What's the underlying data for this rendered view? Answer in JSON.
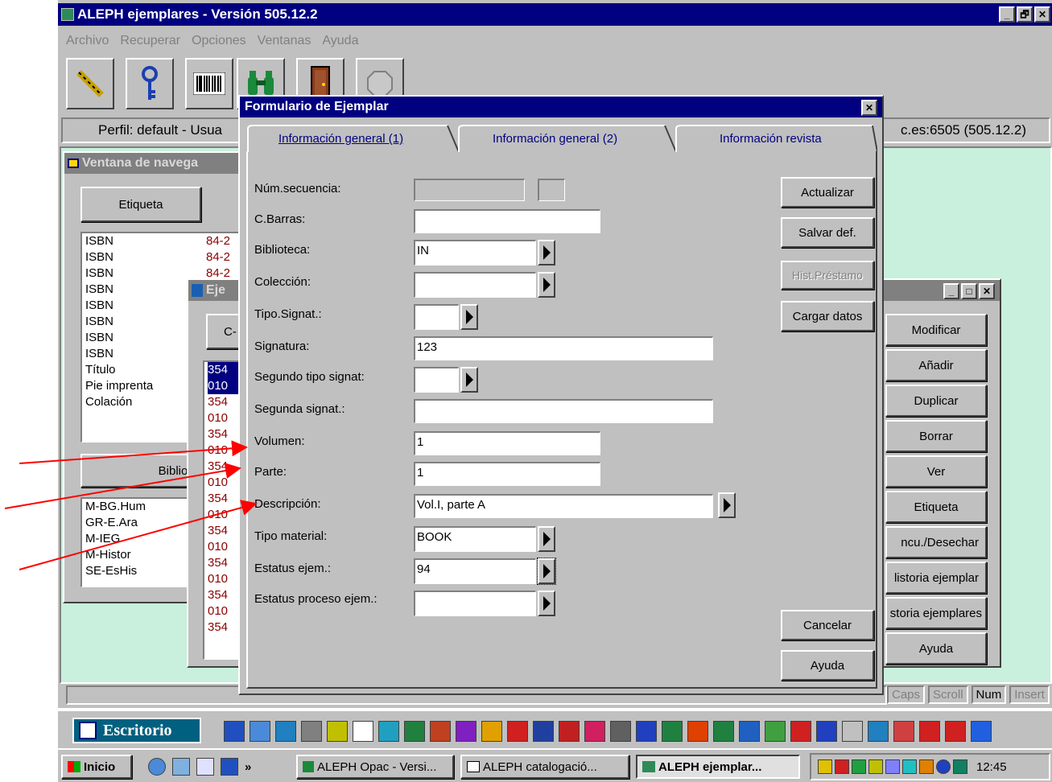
{
  "app": {
    "title": "ALEPH ejemplares - Versión 505.12.2",
    "window_buttons": [
      "_",
      "🗗",
      "✕"
    ],
    "menu": [
      "Archivo",
      "Recuperar",
      "Opciones",
      "Ventanas",
      "Ayuda"
    ],
    "toolbar_icons": [
      "connect-icon",
      "key-icon",
      "barcode-icon",
      "binoculars-icon",
      "door-icon",
      "blank-icon"
    ],
    "profile_left": "Perfil: default - Usua",
    "profile_right": "c.es:6505 (505.12.2)"
  },
  "nav_window": {
    "title": "Ventana de navega",
    "tab": "Etiqueta",
    "rows": [
      {
        "label": "ISBN",
        "value": "84-2"
      },
      {
        "label": "ISBN",
        "value": "84-2"
      },
      {
        "label": "ISBN",
        "value": "84-2"
      },
      {
        "label": "ISBN",
        "value": ""
      },
      {
        "label": "ISBN",
        "value": ""
      },
      {
        "label": "ISBN",
        "value": ""
      },
      {
        "label": "ISBN",
        "value": ""
      },
      {
        "label": "ISBN",
        "value": ""
      },
      {
        "label": "Título",
        "value": ""
      },
      {
        "label": "Pie imprenta",
        "value": ""
      },
      {
        "label": "Colación",
        "value": ""
      }
    ],
    "bibliotec_button": "Bibliotec",
    "libraries": [
      "M-BG.Hum",
      "GR-E.Ara",
      "M-IEG",
      "M-Histor",
      "SE-EsHis"
    ]
  },
  "ej_window": {
    "title": "Eje",
    "tab": "C-",
    "codes": [
      "354",
      "010",
      "354",
      "010",
      "354",
      "010",
      "354",
      "010",
      "354",
      "010",
      "354",
      "010",
      "354",
      "010",
      "354",
      "010",
      "354"
    ]
  },
  "right_panel": {
    "buttons": [
      "Modificar",
      "Añadir",
      "Duplicar",
      "Borrar",
      "Ver",
      "Etiqueta",
      "ncu./Desechar",
      "listoria ejemplar",
      "storia ejemplares",
      "Ayuda"
    ]
  },
  "status_bar": {
    "indicators": [
      "Caps",
      "Scroll",
      "Num",
      "Insert"
    ]
  },
  "dialog": {
    "title": "Formulario de Ejemplar",
    "close": "✕",
    "tabs": [
      "Información general (1)",
      "Información general (2)",
      "Información revista"
    ],
    "fields": [
      {
        "label": "Núm.secuencia:",
        "value": ""
      },
      {
        "label": "C.Barras:",
        "value": ""
      },
      {
        "label": "Biblioteca:",
        "value": "IN"
      },
      {
        "label": "Colección:",
        "value": ""
      },
      {
        "label": "Tipo.Signat.:",
        "value": ""
      },
      {
        "label": "Signatura:",
        "value": "123"
      },
      {
        "label": "Segundo tipo signat:",
        "value": ""
      },
      {
        "label": "Segunda signat.:",
        "value": ""
      },
      {
        "label": "Volumen:",
        "value": "1"
      },
      {
        "label": "Parte:",
        "value": "1"
      },
      {
        "label": "Descripción:",
        "value": "Vol.I, parte A"
      },
      {
        "label": "Tipo material:",
        "value": "BOOK"
      },
      {
        "label": "Estatus ejem.:",
        "value": "94"
      },
      {
        "label": "Estatus proceso ejem.:",
        "value": ""
      }
    ],
    "buttons": {
      "actualizar": "Actualizar",
      "salvar": "Salvar def.",
      "hist": "Hist.Préstamo",
      "cargar": "Cargar datos",
      "cancelar": "Cancelar",
      "ayuda": "Ayuda"
    }
  },
  "taskbar_top": {
    "label": "Escritorio"
  },
  "taskbar": {
    "start": "Inicio",
    "tasks": [
      "ALEPH Opac - Versi...",
      "ALEPH catalogació...",
      "ALEPH ejemplar..."
    ],
    "clock": "12:45"
  },
  "colors": {
    "title_active": "#000080",
    "workspace": "#c8f0dc",
    "gray": "#c0c0c0",
    "annotation": "#ff0000",
    "selection": "#000080",
    "list_red": "#8b0000"
  }
}
